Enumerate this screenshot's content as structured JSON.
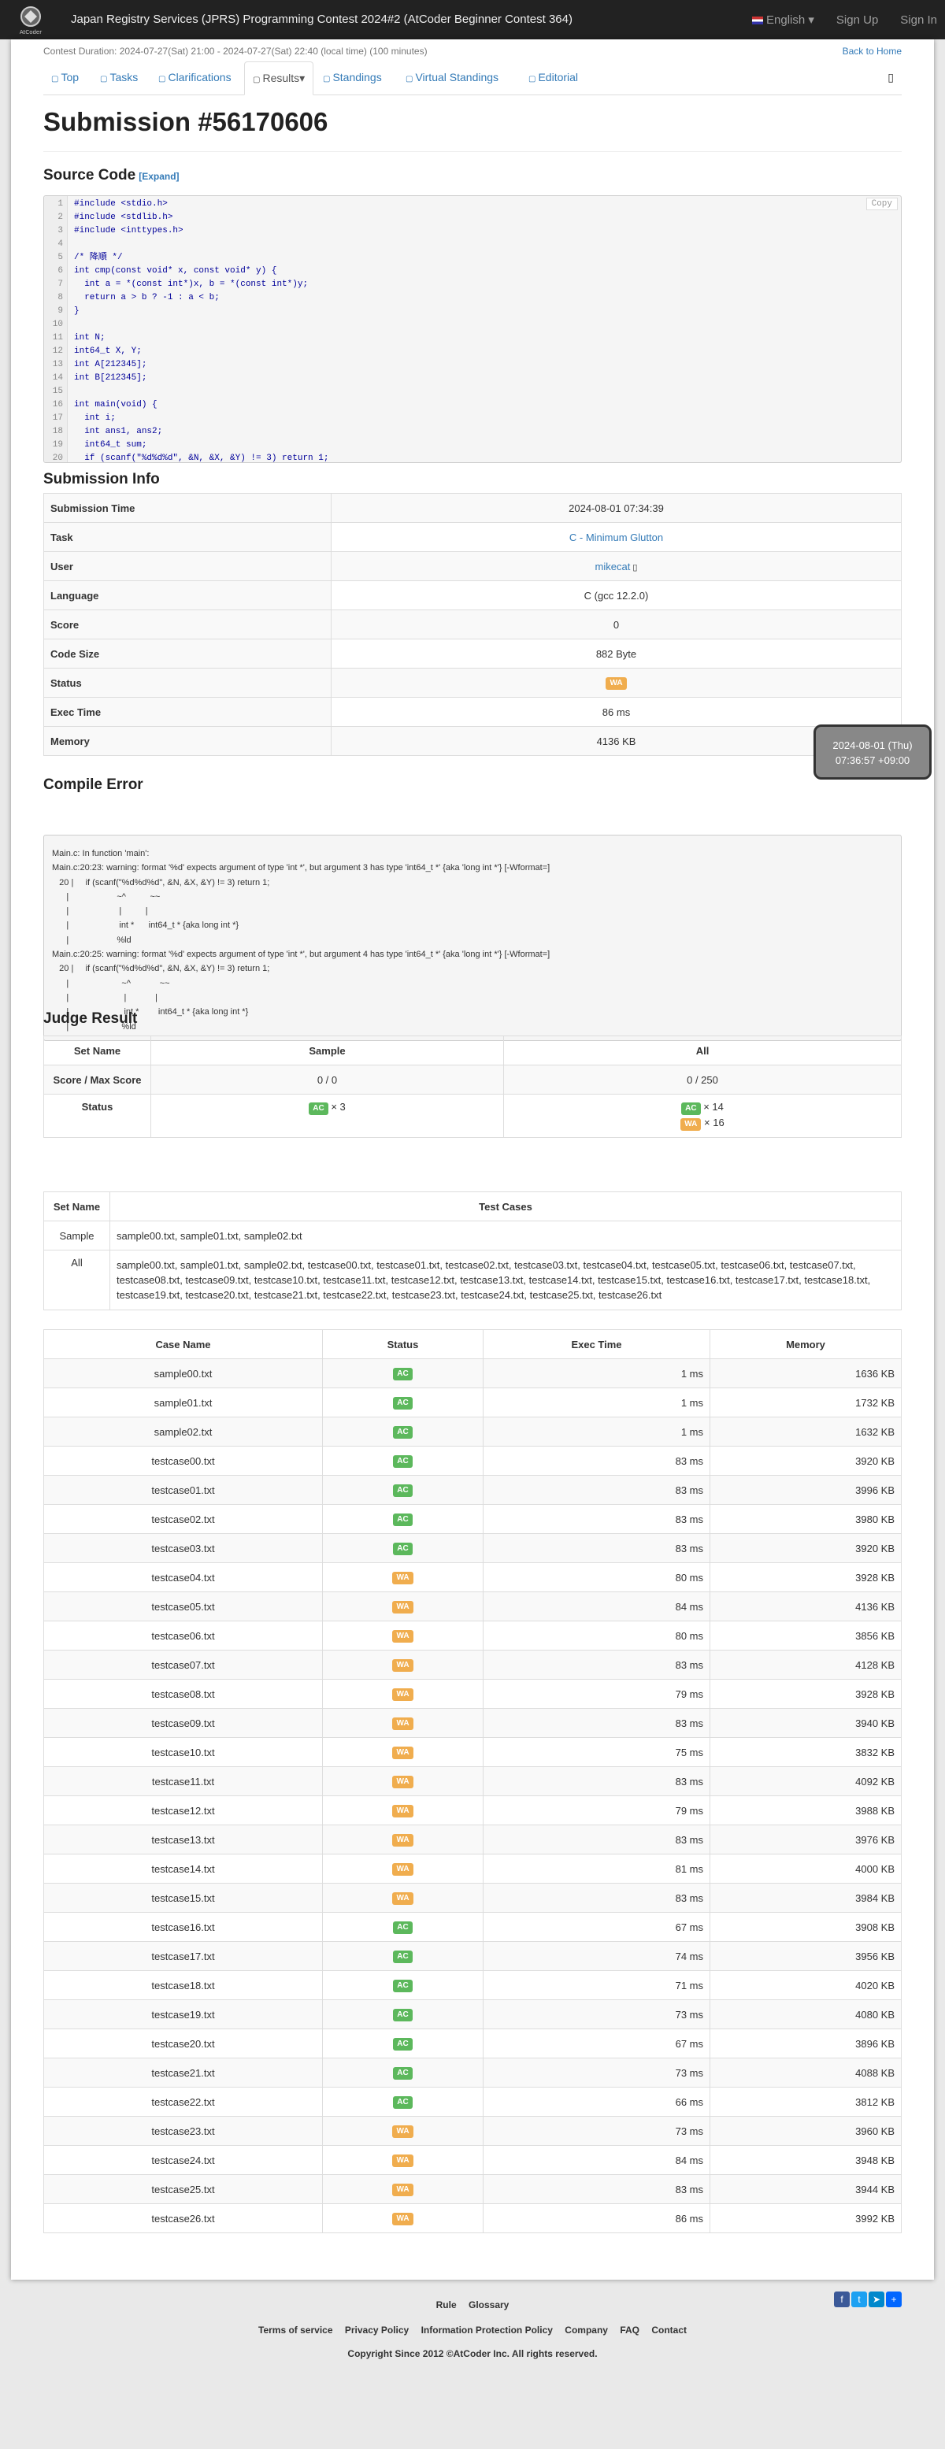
{
  "navbar": {
    "title": "Japan Registry Services (JPRS) Programming Contest 2024#2 (AtCoder Beginner Contest 364)",
    "language": "English",
    "signup": "Sign Up",
    "signin": "Sign In",
    "logo_text": "AtCoder"
  },
  "contest": {
    "duration": "Contest Duration: 2024-07-27(Sat) 21:00 - 2024-07-27(Sat) 22:40 (local time) (100 minutes)",
    "back": "Back to Home"
  },
  "tabs": [
    {
      "label": "Top",
      "icon": "home-icon"
    },
    {
      "label": "Tasks",
      "icon": "tasks-icon"
    },
    {
      "label": "Clarifications",
      "icon": "question-icon"
    },
    {
      "label": "Results",
      "icon": "list-icon"
    },
    {
      "label": "Standings",
      "icon": "sort-icon"
    },
    {
      "label": "Virtual Standings",
      "icon": "sort-icon"
    },
    {
      "label": "Editorial",
      "icon": "book-icon"
    }
  ],
  "title": "Submission #56170606",
  "source": {
    "heading": "Source Code",
    "expand": "[Expand]",
    "copy": "Copy",
    "lines": [
      "#include <stdio.h>",
      "#include <stdlib.h>",
      "#include <inttypes.h>",
      "",
      "/* 降順 */",
      "int cmp(const void* x, const void* y) {",
      "  int a = *(const int*)x, b = *(const int*)y;",
      "  return a > b ? -1 : a < b;",
      "}",
      "",
      "int N;",
      "int64_t X, Y;",
      "int A[212345];",
      "int B[212345];",
      "",
      "int main(void) {",
      "  int i;",
      "  int ans1, ans2;",
      "  int64_t sum;",
      "  if (scanf(\"%d%d%d\", &N, &X, &Y) != 3) return 1;"
    ]
  },
  "info": {
    "heading": "Submission Info",
    "rows": [
      {
        "k": "Submission Time",
        "v": "2024-08-01 07:34:39"
      },
      {
        "k": "Task",
        "v": "C - Minimum Glutton"
      },
      {
        "k": "User",
        "v": "mikecat"
      },
      {
        "k": "Language",
        "v": "C (gcc 12.2.0)"
      },
      {
        "k": "Score",
        "v": "0"
      },
      {
        "k": "Code Size",
        "v": "882 Byte"
      },
      {
        "k": "Status",
        "v": "WA"
      },
      {
        "k": "Exec Time",
        "v": "86 ms"
      },
      {
        "k": "Memory",
        "v": "4136 KB"
      }
    ]
  },
  "tooltip": {
    "line1": "2024-08-01 (Thu)",
    "line2": "07:36:57 +09:00"
  },
  "compile": {
    "heading": "Compile Error",
    "lines": [
      "Main.c: In function 'main':",
      "Main.c:20:23: warning: format '%d' expects argument of type 'int *', but argument 3 has type 'int64_t *' {aka 'long int *'} [-Wformat=]",
      "   20 |     if (scanf(\"%d%d%d\", &N, &X, &Y) != 3) return 1;",
      "      |                    ~^          ~~",
      "      |                     |          |",
      "      |                     int *      int64_t * {aka long int *}",
      "      |                    %ld",
      "Main.c:20:25: warning: format '%d' expects argument of type 'int *', but argument 4 has type 'int64_t *' {aka 'long int *'} [-Wformat=]",
      "   20 |     if (scanf(\"%d%d%d\", &N, &X, &Y) != 3) return 1;",
      "      |                      ~^            ~~",
      "      |                       |            |",
      "      |                       int *        int64_t * {aka long int *}",
      "      |                      %ld"
    ]
  },
  "judge": {
    "heading": "Judge Result",
    "h_setname": "Set Name",
    "h_sample": "Sample",
    "h_all": "All",
    "score_label": "Score / Max Score",
    "sample_score": "0 / 0",
    "all_score": "0 / 250",
    "status_label": "Status",
    "ac": "AC",
    "wa": "WA",
    "sample_ac": "× 3",
    "all_ac": "× 14",
    "all_wa": "× 16"
  },
  "sets": {
    "h_setname": "Set Name",
    "h_cases": "Test Cases",
    "sample_name": "Sample",
    "sample_cases": "sample00.txt, sample01.txt, sample02.txt",
    "all_name": "All",
    "all_cases": "sample00.txt, sample01.txt, sample02.txt, testcase00.txt, testcase01.txt, testcase02.txt, testcase03.txt, testcase04.txt, testcase05.txt, testcase06.txt, testcase07.txt, testcase08.txt, testcase09.txt, testcase10.txt, testcase11.txt, testcase12.txt, testcase13.txt, testcase14.txt, testcase15.txt, testcase16.txt, testcase17.txt, testcase18.txt, testcase19.txt, testcase20.txt, testcase21.txt, testcase22.txt, testcase23.txt, testcase24.txt, testcase25.txt, testcase26.txt"
  },
  "cases": {
    "headers": [
      "Case Name",
      "Status",
      "Exec Time",
      "Memory"
    ],
    "rows": [
      [
        "sample00.txt",
        "AC",
        "1 ms",
        "1636 KB"
      ],
      [
        "sample01.txt",
        "AC",
        "1 ms",
        "1732 KB"
      ],
      [
        "sample02.txt",
        "AC",
        "1 ms",
        "1632 KB"
      ],
      [
        "testcase00.txt",
        "AC",
        "83 ms",
        "3920 KB"
      ],
      [
        "testcase01.txt",
        "AC",
        "83 ms",
        "3996 KB"
      ],
      [
        "testcase02.txt",
        "AC",
        "83 ms",
        "3980 KB"
      ],
      [
        "testcase03.txt",
        "AC",
        "83 ms",
        "3920 KB"
      ],
      [
        "testcase04.txt",
        "WA",
        "80 ms",
        "3928 KB"
      ],
      [
        "testcase05.txt",
        "WA",
        "84 ms",
        "4136 KB"
      ],
      [
        "testcase06.txt",
        "WA",
        "80 ms",
        "3856 KB"
      ],
      [
        "testcase07.txt",
        "WA",
        "83 ms",
        "4128 KB"
      ],
      [
        "testcase08.txt",
        "WA",
        "79 ms",
        "3928 KB"
      ],
      [
        "testcase09.txt",
        "WA",
        "83 ms",
        "3940 KB"
      ],
      [
        "testcase10.txt",
        "WA",
        "75 ms",
        "3832 KB"
      ],
      [
        "testcase11.txt",
        "WA",
        "83 ms",
        "4092 KB"
      ],
      [
        "testcase12.txt",
        "WA",
        "79 ms",
        "3988 KB"
      ],
      [
        "testcase13.txt",
        "WA",
        "83 ms",
        "3976 KB"
      ],
      [
        "testcase14.txt",
        "WA",
        "81 ms",
        "4000 KB"
      ],
      [
        "testcase15.txt",
        "WA",
        "83 ms",
        "3984 KB"
      ],
      [
        "testcase16.txt",
        "AC",
        "67 ms",
        "3908 KB"
      ],
      [
        "testcase17.txt",
        "AC",
        "74 ms",
        "3956 KB"
      ],
      [
        "testcase18.txt",
        "AC",
        "71 ms",
        "4020 KB"
      ],
      [
        "testcase19.txt",
        "AC",
        "73 ms",
        "4080 KB"
      ],
      [
        "testcase20.txt",
        "AC",
        "67 ms",
        "3896 KB"
      ],
      [
        "testcase21.txt",
        "AC",
        "73 ms",
        "4088 KB"
      ],
      [
        "testcase22.txt",
        "AC",
        "66 ms",
        "3812 KB"
      ],
      [
        "testcase23.txt",
        "WA",
        "73 ms",
        "3960 KB"
      ],
      [
        "testcase24.txt",
        "WA",
        "84 ms",
        "3948 KB"
      ],
      [
        "testcase25.txt",
        "WA",
        "83 ms",
        "3944 KB"
      ],
      [
        "testcase26.txt",
        "WA",
        "86 ms",
        "3992 KB"
      ]
    ]
  },
  "footer": {
    "rule": "Rule",
    "glossary": "Glossary",
    "terms": "Terms of service",
    "privacy": "Privacy Policy",
    "info": "Information Protection Policy",
    "company": "Company",
    "faq": "FAQ",
    "contact": "Contact",
    "copyright": "Copyright Since 2012 ©AtCoder Inc. All rights reserved."
  }
}
